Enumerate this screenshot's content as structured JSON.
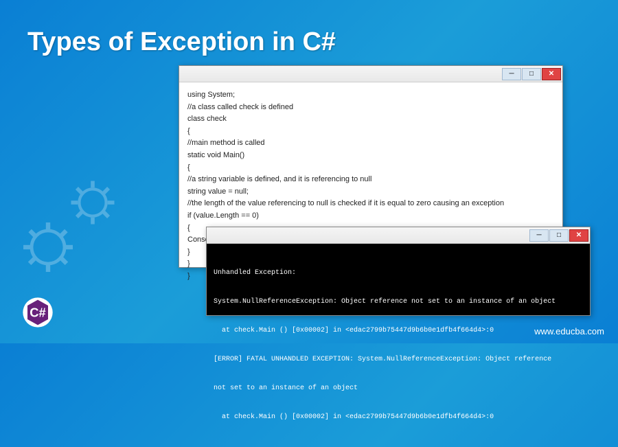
{
  "title": "Types of Exception in C#",
  "watermark": "www.educba.com",
  "code": {
    "line1": "using System;",
    "line2": "//a class called check is defined",
    "line3": "class check",
    "line4": "{",
    "line5": "//main method is called",
    "line6": "static void Main()",
    "line7": "{",
    "line8": "//a string variable is defined, and it is referencing to null",
    "line9": "string value = null;",
    "line10": "//the length of the value referencing to null is checked if it is equal to zero causing an exception",
    "line11": "if (value.Length == 0)",
    "line12": "{",
    "line13": "Console.WriteLin",
    "line14": "}",
    "line15": "}",
    "line16": "}"
  },
  "console": {
    "line1": "Unhandled Exception:",
    "line2": "System.NullReferenceException: Object reference not set to an instance of an object",
    "line3": "  at check.Main () [0x00002] in <edac2799b75447d9b6b0e1dfb4f664d4>:0",
    "line4": "[ERROR] FATAL UNHANDLED EXCEPTION: System.NullReferenceException: Object reference",
    "line5": "not set to an instance of an object",
    "line6": "  at check.Main () [0x00002] in <edac2799b75447d9b6b0e1dfb4f664d4>:0"
  }
}
